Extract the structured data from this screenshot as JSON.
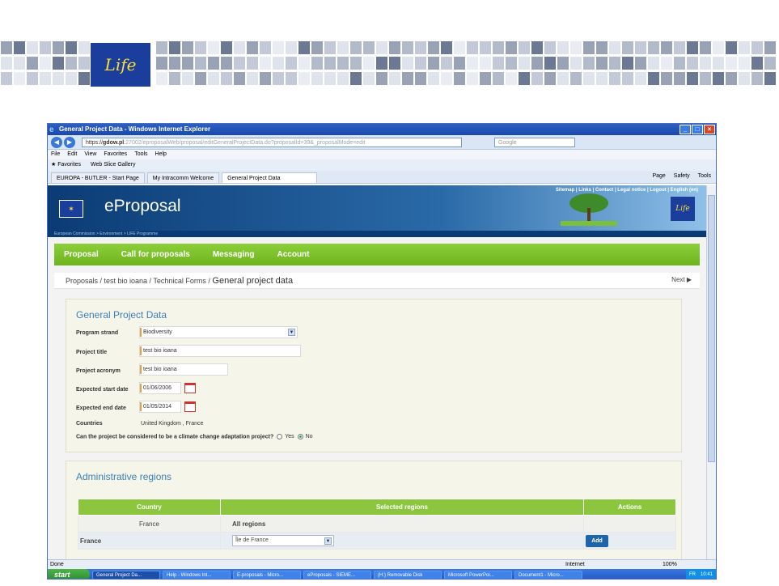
{
  "browser": {
    "window_title": "General Project Data - Windows Internet Explorer",
    "address_prefix": "https",
    "address_host": "gdow.pl",
    "address_rest": ":27002/eproposalWeb/proposal/editGeneralProjectData.do?proposalId=39&_proposalMode=edit",
    "search_placeholder": "Google",
    "menu": [
      "File",
      "Edit",
      "View",
      "Favorites",
      "Tools",
      "Help"
    ],
    "favorites_label": "Favorites",
    "web_slice_label": "Web Slice Gallery",
    "tabs": [
      "EUROPA - BUTLER - Start Page",
      "My Intracomm Welcome",
      "General Project Data"
    ],
    "toolbar_items": [
      "Page",
      "Safety",
      "Tools"
    ],
    "status_left": "Done",
    "status_zone": "Internet",
    "status_zoom": "100%"
  },
  "site": {
    "top_links": "Sitemap | Links | Contact | Legal notice | Logout | English (en)",
    "title": "eProposal",
    "sub_breadcrumb": "European Commission > Environment > LIFE Programme",
    "nav": [
      "Proposal",
      "Call for proposals",
      "Messaging",
      "Account"
    ]
  },
  "crumb": {
    "path": "Proposals / test bio ioana / Technical Forms / ",
    "current": "General project data",
    "next": "Next"
  },
  "general_project_data": {
    "heading": "General Project Data",
    "program_strand_label": "Program strand",
    "program_strand_value": "Biodiversity",
    "project_title_label": "Project title",
    "project_title_value": "test bio ioana",
    "project_acronym_label": "Project acronym",
    "project_acronym_value": "test bio ioana",
    "start_date_label": "Expected start date",
    "start_date_value": "01/06/2006",
    "end_date_label": "Expected end date",
    "end_date_value": "01/05/2014",
    "countries_label": "Countries",
    "countries_value": "United Kingdom , France",
    "climate_question": "Can the project be considered to be a climate change adaptation project?",
    "yes_label": "Yes",
    "no_label": "No",
    "climate_selected": "No"
  },
  "administrative_regions": {
    "heading": "Administrative regions",
    "columns": [
      "Country",
      "Selected regions",
      "Actions"
    ],
    "rows": [
      {
        "country": "France",
        "regions": "All regions"
      },
      {
        "country": "France",
        "region_select": "Île de France",
        "action": "Add"
      }
    ]
  },
  "taskbar": {
    "start": "start",
    "tasks": [
      "General Project Da...",
      "Help - Windows Int...",
      "E-proposals - Micro...",
      "eProposals - SIEME...",
      "(H:) Removable Disk",
      "Microsoft PowerPoi...",
      "Document1 - Micro..."
    ],
    "lang": "FR",
    "clock": "10:41"
  },
  "slide_logo_text": "Life",
  "colors": {
    "nav_green": "#7dbf2c",
    "header_blue": "#0b3b74",
    "heading_blue": "#3b7fb5",
    "add_button": "#1f63a8"
  }
}
